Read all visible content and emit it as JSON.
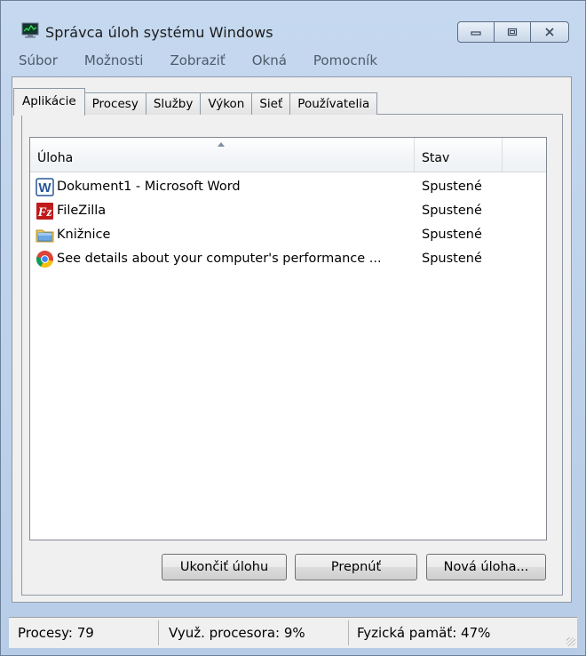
{
  "window": {
    "title": "Správca úloh systému Windows",
    "controls": {
      "minimize": "minimize-icon",
      "maximize": "maximize-icon",
      "close": "close-icon"
    }
  },
  "menu": [
    "Súbor",
    "Možnosti",
    "Zobraziť",
    "Okná",
    "Pomocník"
  ],
  "tabs": [
    "Aplikácie",
    "Procesy",
    "Služby",
    "Výkon",
    "Sieť",
    "Používatelia"
  ],
  "active_tab": "Aplikácie",
  "table": {
    "columns": [
      "Úloha",
      "Stav"
    ],
    "rows": [
      {
        "icon": "word-icon",
        "task": "Dokument1 - Microsoft Word",
        "status": "Spustené"
      },
      {
        "icon": "filezilla-icon",
        "task": "FileZilla",
        "status": "Spustené"
      },
      {
        "icon": "library-folder-icon",
        "task": "Knižnice",
        "status": "Spustené"
      },
      {
        "icon": "chrome-icon",
        "task": "See details about your computer's performance ...",
        "status": "Spustené"
      }
    ]
  },
  "buttons": {
    "end_task": "Ukončiť úlohu",
    "switch": "Prepnúť",
    "new_task": "Nová úloha..."
  },
  "status_bar": {
    "processes": "Procesy: 79",
    "cpu": "Využ. procesora: 9%",
    "memory": "Fyzická pamäť: 47%"
  },
  "colors": {
    "frame": "#bcd1ea",
    "panel": "#f0f0f0",
    "word_blue": "#2a5699",
    "filezilla_red": "#bf1b1b"
  }
}
